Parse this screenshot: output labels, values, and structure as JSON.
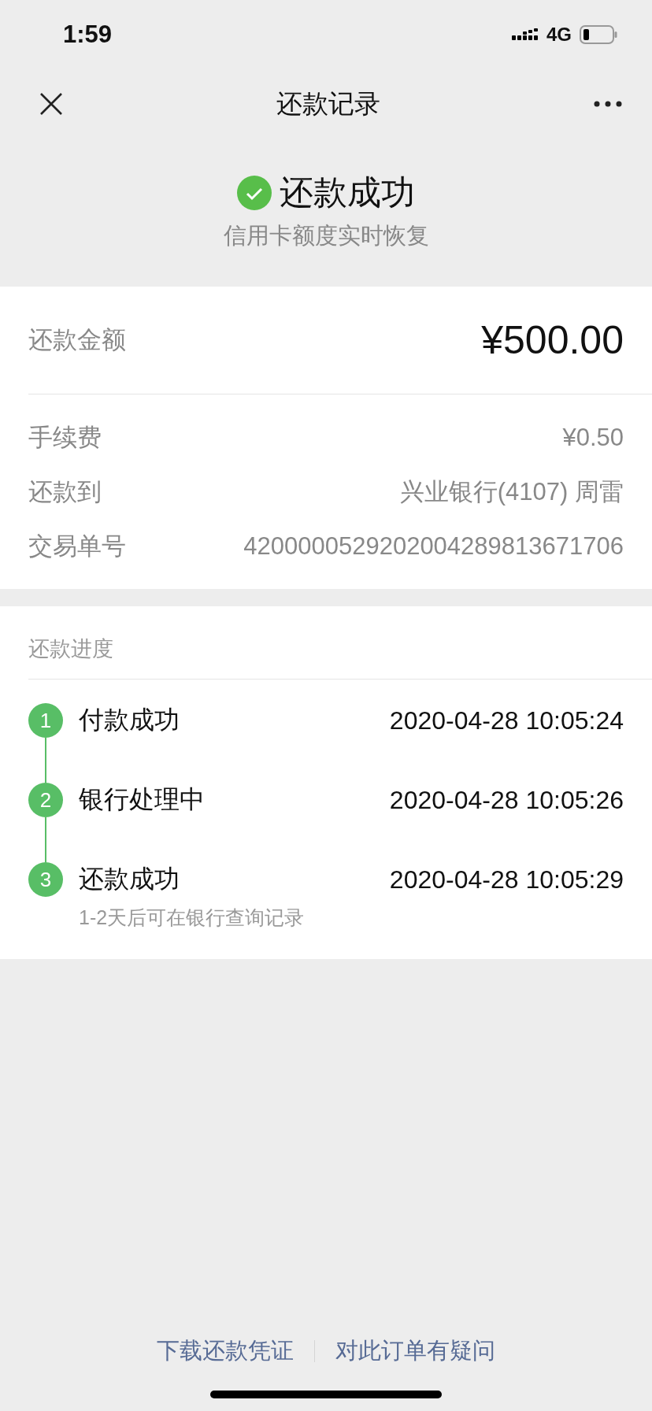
{
  "status_bar": {
    "time": "1:59",
    "network": "4G"
  },
  "nav": {
    "title": "还款记录"
  },
  "result": {
    "title": "还款成功",
    "subtitle": "信用卡额度实时恢复"
  },
  "amount": {
    "label": "还款金额",
    "value": "¥500.00"
  },
  "details": [
    {
      "label": "手续费",
      "value": "¥0.50"
    },
    {
      "label": "还款到",
      "value": "兴业银行(4107) 周雷"
    },
    {
      "label": "交易单号",
      "value": "4200000529202004289813671706"
    }
  ],
  "progress": {
    "title": "还款进度",
    "steps": [
      {
        "number": "1",
        "label": "付款成功",
        "time": "2020-04-28 10:05:24"
      },
      {
        "number": "2",
        "label": "银行处理中",
        "time": "2020-04-28 10:05:26"
      },
      {
        "number": "3",
        "label": "还款成功",
        "time": "2020-04-28 10:05:29",
        "note": "1-2天后可在银行查询记录"
      }
    ]
  },
  "footer_links": [
    "下载还款凭证",
    "对此订单有疑问"
  ]
}
